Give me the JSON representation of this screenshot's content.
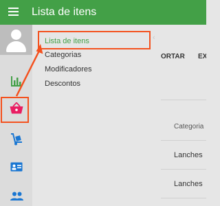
{
  "header": {
    "title": "Lista de itens",
    "menu_icon": "hamburger-menu-icon"
  },
  "rail": {
    "items": [
      {
        "name": "avatar",
        "icon": "user-avatar-icon"
      },
      {
        "name": "reports",
        "icon": "bar-chart-icon",
        "color": "#43a047"
      },
      {
        "name": "items",
        "icon": "shopping-basket-icon",
        "color": "#e91e63",
        "active": true
      },
      {
        "name": "inventory",
        "icon": "hand-truck-icon",
        "color": "#1976d2"
      },
      {
        "name": "employees",
        "icon": "id-card-icon",
        "color": "#1976d2"
      },
      {
        "name": "customers",
        "icon": "people-icon",
        "color": "#1976d2"
      }
    ]
  },
  "submenu": {
    "items": [
      {
        "label": "Lista de itens",
        "active": true
      },
      {
        "label": "Categorias"
      },
      {
        "label": "Modificadores"
      },
      {
        "label": "Descontos"
      }
    ]
  },
  "background": {
    "export_label": "ORTAR",
    "ex_label": "EX",
    "column_header": "Categoria",
    "rows": [
      "Lanches",
      "Lanches"
    ]
  },
  "colors": {
    "brand": "#43a047",
    "highlight": "#f4511e",
    "basket": "#e91e63",
    "icon_blue": "#1976d2"
  }
}
